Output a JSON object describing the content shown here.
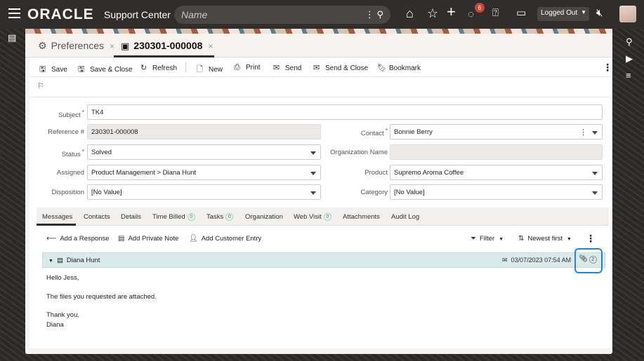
{
  "header": {
    "logo": "ORACLE",
    "app_title": "Support Center",
    "search_placeholder": "Name",
    "notification_count": "6",
    "login_status": "Logged Out"
  },
  "doc_tabs": [
    {
      "label": "Preferences",
      "active": false
    },
    {
      "label": "230301-000008",
      "active": true
    }
  ],
  "toolbar": {
    "save": "Save",
    "save_close": "Save & Close",
    "refresh": "Refresh",
    "new": "New",
    "print": "Print",
    "send": "Send",
    "send_close": "Send & Close",
    "bookmark": "Bookmark"
  },
  "form": {
    "subject_label": "Subject",
    "subject_value": "TK4",
    "reference_label": "Reference #",
    "reference_value": "230301-000008",
    "contact_label": "Contact",
    "contact_value": "Bonnie Berry",
    "status_label": "Status",
    "status_value": "Solved",
    "org_label": "Organization Name",
    "org_value": "",
    "assigned_label": "Assigned",
    "assigned_value": "Product Management > Diana Hunt",
    "product_label": "Product",
    "product_value": "Supremo Aroma Coffee",
    "disposition_label": "Disposition",
    "disposition_value": "[No Value]",
    "category_label": "Category",
    "category_value": "[No Value]"
  },
  "sub_tabs": [
    {
      "label": "Messages",
      "count": null
    },
    {
      "label": "Contacts",
      "count": null
    },
    {
      "label": "Details",
      "count": null
    },
    {
      "label": "Time Billed",
      "count": "0"
    },
    {
      "label": "Tasks",
      "count": "0"
    },
    {
      "label": "Organization",
      "count": null
    },
    {
      "label": "Web Visit",
      "count": "0"
    },
    {
      "label": "Attachments",
      "count": null
    },
    {
      "label": "Audit Log",
      "count": null
    }
  ],
  "messages_toolbar": {
    "add_response": "Add a Response",
    "add_private_note": "Add Private Note",
    "add_customer_entry": "Add Customer Entry",
    "filter": "Filter",
    "sort": "Newest first"
  },
  "message": {
    "author": "Diana Hunt",
    "date": "03/07/2023 07:54 AM",
    "attachment_count": "2",
    "body": [
      "Hello Jess,",
      "The files you requested are attached.",
      "Thank you,",
      "Diana"
    ]
  }
}
